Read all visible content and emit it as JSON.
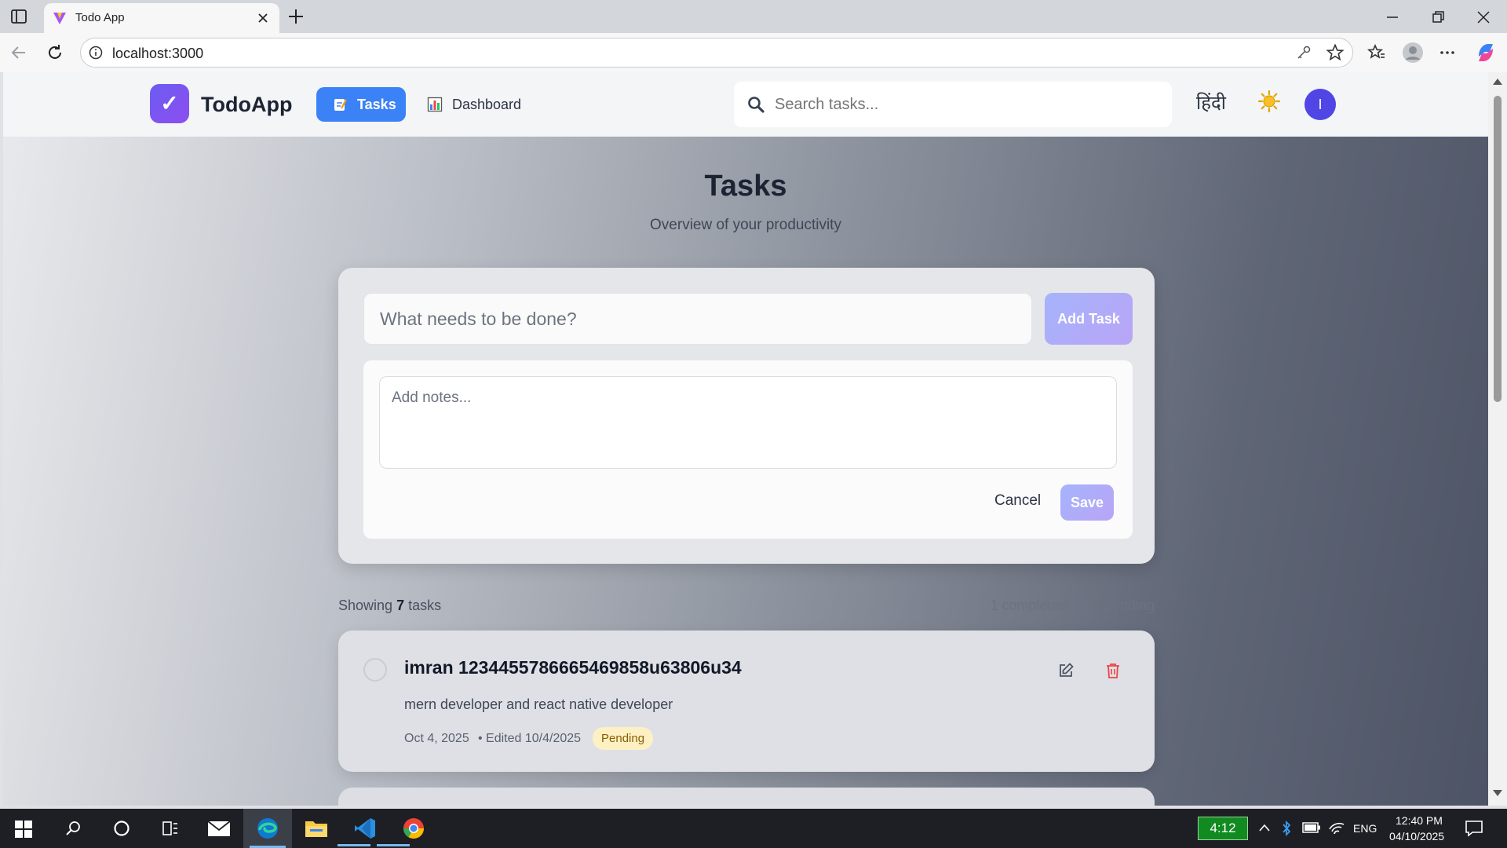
{
  "browser": {
    "tab_title": "Todo App",
    "url": "localhost:3000"
  },
  "navbar": {
    "logo_symbol": "✓",
    "brand": "TodoApp",
    "tabs": [
      {
        "icon": "memo-icon",
        "label": "Tasks",
        "active": true
      },
      {
        "icon": "bar-chart-icon",
        "label": "Dashboard",
        "active": false
      }
    ],
    "search_placeholder": "Search tasks...",
    "language": "हिंदी",
    "avatar_initial": "I"
  },
  "header": {
    "title": "Tasks",
    "subtitle": "Overview of your productivity"
  },
  "new_task": {
    "placeholder": "What needs to be done?",
    "add_label": "Add Task",
    "notes_placeholder": "Add notes...",
    "cancel_label": "Cancel",
    "save_label": "Save"
  },
  "summary": {
    "showing_prefix": "Showing",
    "count": "7",
    "showing_suffix": "tasks",
    "completed": "1 completed",
    "separator": "•",
    "pending": "6 pending"
  },
  "tasks": [
    {
      "title": "imran 1234455786665469858u63806u34",
      "description": "mern developer and react native developer",
      "date": "Oct 4, 2025",
      "edited": "• Edited 10/4/2025",
      "status": "Pending",
      "completed": false
    }
  ],
  "taskbar": {
    "battery_time": "4:12",
    "language": "ENG",
    "time": "12:40 PM",
    "date": "04/10/2025"
  },
  "colors": {
    "accent": "#3b82f6",
    "logo": "#7c4df0",
    "pending_badge": "#fdf1c3",
    "delete": "#ef4444"
  }
}
